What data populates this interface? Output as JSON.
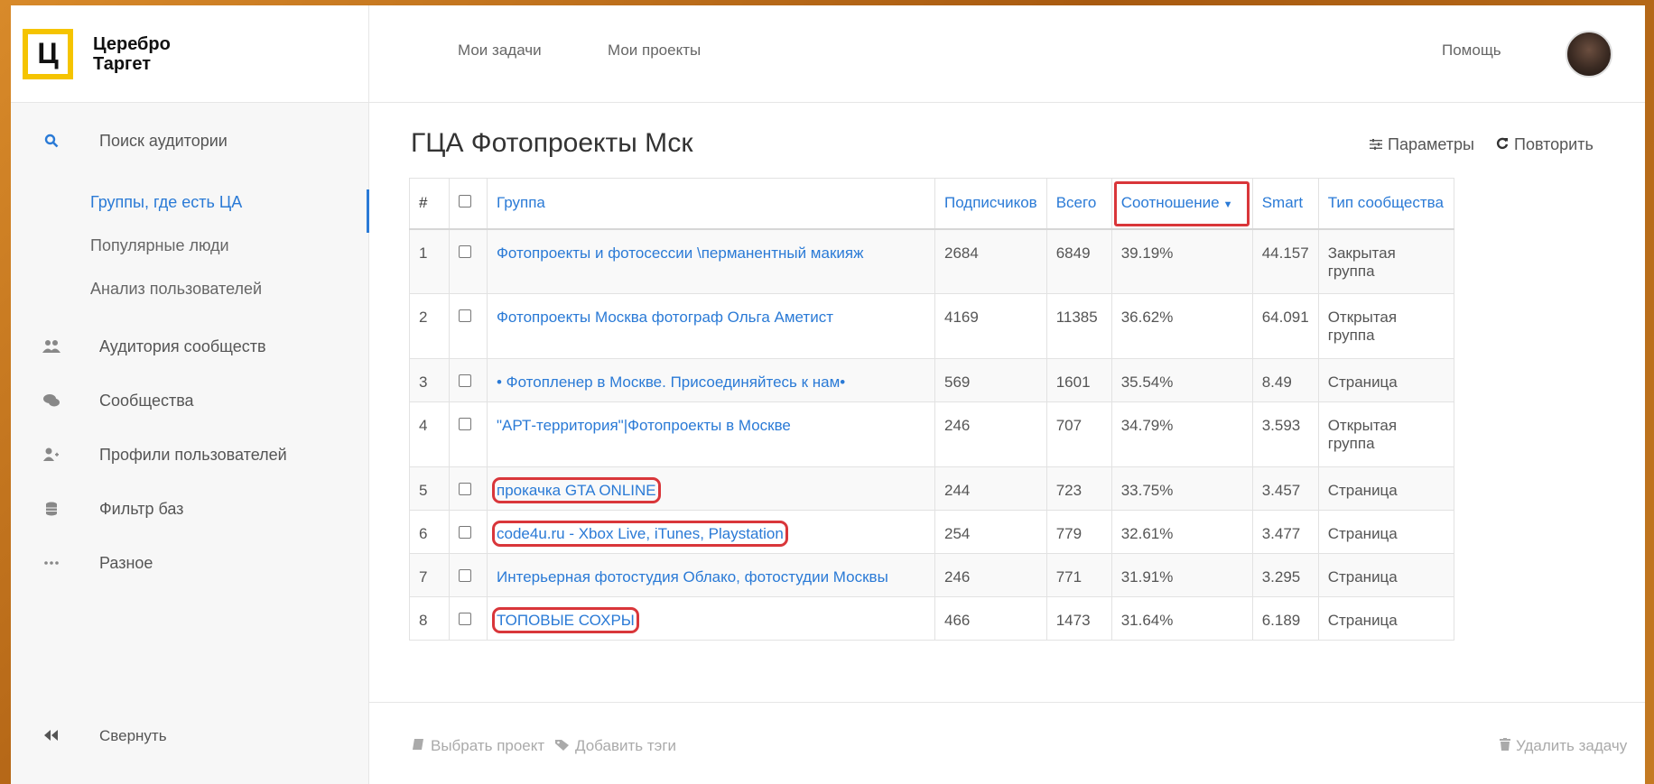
{
  "brand": {
    "logo_letter": "Ц",
    "name_line1": "Церебро",
    "name_line2": "Таргет"
  },
  "topbar": {
    "my_tasks": "Мои задачи",
    "my_projects": "Мои проекты",
    "help": "Помощь"
  },
  "sidebar": {
    "audience_search": "Поиск аудитории",
    "sub_items": [
      "Группы, где есть ЦА",
      "Популярные люди",
      "Анализ пользователей"
    ],
    "items": [
      "Аудитория сообществ",
      "Сообщества",
      "Профили пользователей",
      "Фильтр баз",
      "Разное"
    ],
    "collapse": "Свернуть"
  },
  "main": {
    "title": "ГЦА Фотопроекты Мск",
    "params": "Параметры",
    "repeat": "Повторить"
  },
  "table": {
    "headers": [
      "#",
      "Группа",
      "Подписчиков",
      "Всего",
      "Соотношение",
      "Smart",
      "Тип сообщества"
    ],
    "rows": [
      {
        "n": "1",
        "group": "Фотопроекты и фотосессии \\перманентный макияж",
        "subs": "2684",
        "total": "6849",
        "ratio": "39.19%",
        "smart": "44.157",
        "type1": "Закрытая",
        "type2": "группа"
      },
      {
        "n": "2",
        "group": "Фотопроекты Москва фотограф Ольга Аметист",
        "subs": "4169",
        "total": "11385",
        "ratio": "36.62%",
        "smart": "64.091",
        "type1": "Открытая",
        "type2": "группа"
      },
      {
        "n": "3",
        "group": "• Фотопленер в Москве. Присоединяйтесь к нам•",
        "subs": "569",
        "total": "1601",
        "ratio": "35.54%",
        "smart": "8.49",
        "type1": "Страница",
        "type2": ""
      },
      {
        "n": "4",
        "group": "\"АРТ-территория\"|Фотопроекты в Москве",
        "subs": "246",
        "total": "707",
        "ratio": "34.79%",
        "smart": "3.593",
        "type1": "Открытая",
        "type2": "группа"
      },
      {
        "n": "5",
        "group": "прокачка GTA ONLINE",
        "subs": "244",
        "total": "723",
        "ratio": "33.75%",
        "smart": "3.457",
        "type1": "Страница",
        "type2": ""
      },
      {
        "n": "6",
        "group": "code4u.ru - Xbox Live, iTunes, Playstation",
        "subs": "254",
        "total": "779",
        "ratio": "32.61%",
        "smart": "3.477",
        "type1": "Страница",
        "type2": ""
      },
      {
        "n": "7",
        "group": "Интерьерная фотостудия Облако, фотостудии Москвы",
        "subs": "246",
        "total": "771",
        "ratio": "31.91%",
        "smart": "3.295",
        "type1": "Страница",
        "type2": ""
      },
      {
        "n": "8",
        "group": "ТОПОВЫЕ СОХРЫ",
        "subs": "466",
        "total": "1473",
        "ratio": "31.64%",
        "smart": "6.189",
        "type1": "Страница",
        "type2": ""
      }
    ]
  },
  "footer": {
    "choose_project": "Выбрать проект",
    "add_tags": "Добавить тэги",
    "delete_task": "Удалить задачу"
  },
  "colors": {
    "accent": "#2a7ad6",
    "highlight": "#d9363a",
    "logo": "#f5c400"
  }
}
